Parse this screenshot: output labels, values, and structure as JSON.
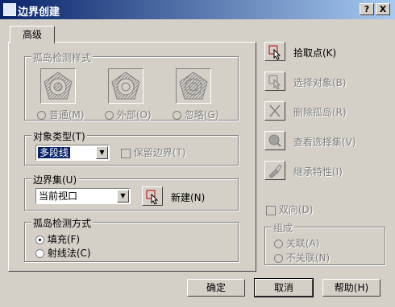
{
  "window": {
    "title": "边界创建",
    "help_btn": "?",
    "close_btn": "X"
  },
  "tab": {
    "label": "高级"
  },
  "island_style": {
    "legend": "孤岛检测样式",
    "options": [
      {
        "label": "普通(M)",
        "checked": false
      },
      {
        "label": "外部(O)",
        "checked": false
      },
      {
        "label": "忽略(G)",
        "checked": false
      }
    ]
  },
  "object_type": {
    "legend": "对象类型(T)",
    "selected": "多段线",
    "retain_label": "保留边界(T)"
  },
  "boundary_set": {
    "legend": "边界集(U)",
    "selected": "当前视口",
    "new_label": "新建(N)"
  },
  "island_method": {
    "legend": "孤岛检测方式",
    "options": [
      {
        "label": "填充(F)",
        "checked": true
      },
      {
        "label": "射线法(C)",
        "checked": false
      }
    ]
  },
  "actions": [
    {
      "label": "拾取点(K)",
      "enabled": true,
      "icon": "pick-point-icon"
    },
    {
      "label": "选择对象(B)",
      "enabled": false,
      "icon": "select-objects-icon"
    },
    {
      "label": "删除孤岛(R)",
      "enabled": false,
      "icon": "remove-islands-icon"
    },
    {
      "label": "查看选择集(V)",
      "enabled": false,
      "icon": "view-selection-icon"
    },
    {
      "label": "继承特性(I)",
      "enabled": false,
      "icon": "inherit-properties-icon"
    }
  ],
  "double": {
    "label": "双向(D)"
  },
  "composition": {
    "legend": "组成",
    "options": [
      {
        "label": "关联(A)"
      },
      {
        "label": "不关联(N)"
      }
    ]
  },
  "buttons": {
    "ok": "确定",
    "cancel": "取消",
    "help": "帮助(H)"
  }
}
